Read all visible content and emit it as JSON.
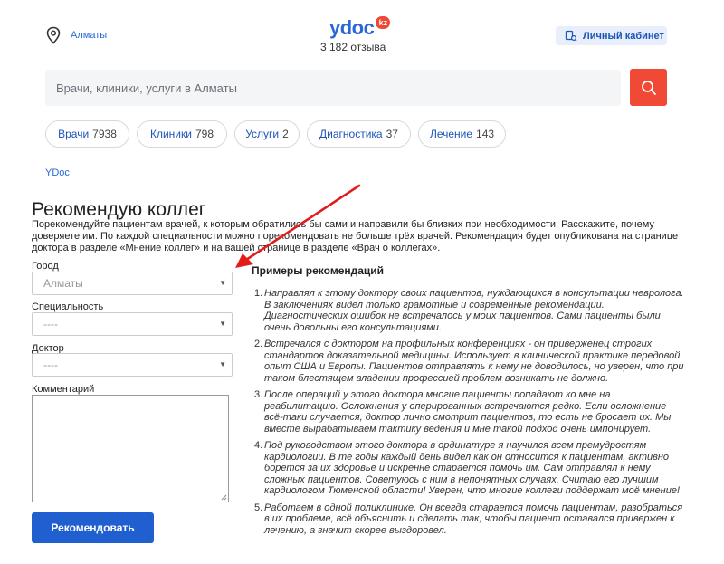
{
  "header": {
    "city": "Алматы",
    "logo_text": "ydoc",
    "logo_badge": "kz",
    "reviews": "3 182 отзыва",
    "cabinet_label": "Личный кабинет"
  },
  "search": {
    "placeholder": "Врачи, клиники, услуги в Алматы"
  },
  "chips": [
    {
      "label": "Врачи",
      "count": "7938"
    },
    {
      "label": "Клиники",
      "count": "798"
    },
    {
      "label": "Услуги",
      "count": "2"
    },
    {
      "label": "Диагностика",
      "count": "37"
    },
    {
      "label": "Лечение",
      "count": "143"
    }
  ],
  "breadcrumb": "YDoc",
  "page": {
    "title": "Рекомендую коллег",
    "description": "Порекомендуйте пациентам врачей, к которым обратились бы сами и направили бы близких при необходимости. Расскажите, почему доверяете им. По каждой специальности можно порекомендовать не больше трёх врачей. Рекомендация будет опубликована на странице доктора в разделе «Мнение коллег» и на вашей странице в разделе «Врач о коллегах»."
  },
  "form": {
    "city_label": "Город",
    "city_value": "Алматы",
    "specialty_label": "Специальность",
    "specialty_value": "----",
    "doctor_label": "Доктор",
    "doctor_value": "----",
    "comment_label": "Комментарий",
    "submit_label": "Рекомендовать"
  },
  "examples": {
    "title": "Примеры рекомендаций",
    "items": [
      {
        "num": "1.",
        "text": "Направлял к этому доктору своих пациентов, нуждающихся в консультации невролога. В заключениях видел только грамотные и современные рекомендации. Диагностических ошибок не встречалось у моих пациентов. Сами пациенты были очень довольны его консультациями."
      },
      {
        "num": "2.",
        "text": "Встречался с доктором на профильных конференциях - он приверженец строгих стандартов доказательной медицины. Использует в клинической практике передовой опыт США и Европы. Пациентов отправлять к нему не доводилось, но уверен, что при таком блестящем владении профессией проблем возникать не должно."
      },
      {
        "num": "3.",
        "text": "После операций у этого доктора многие пациенты попадают ко мне на реабилитацию. Осложнения у оперированных встречаются редко. Если осложнение всё-таки случается, доктор лично смотрит пациентов, то есть не бросает их. Мы вместе вырабатываем тактику ведения и мне такой подход очень импонирует."
      },
      {
        "num": "4.",
        "text": "Под руководством этого доктора в ординатуре я научился всем премудростям кардиологии. В те годы каждый день видел как он относится к пациентам, активно борется за их здоровье и искренне старается помочь им. Сам отправлял к нему сложных пациентов. Советуюсь с ним в непонятных случаях. Считаю его лучшим кардиологом Тюменской области! Уверен, что многие коллеги поддержат моё мнение!"
      },
      {
        "num": "5.",
        "text": "Работаем в одной поликлинике. Он всегда старается помочь пациентам, разобраться в их проблеме, всё объяснить и сделать так, чтобы пациент оставался привержен к лечению, а значит скорее выздоровел."
      }
    ]
  },
  "colors": {
    "brand_blue": "#2b68d6",
    "accent_red": "#f04a36",
    "button_blue": "#1f5fcf",
    "annotation_arrow": "#e21b1b"
  },
  "icons": [
    "location-pin-icon",
    "cabinet-user-icon",
    "search-icon",
    "chevron-down-icon",
    "annotation-arrow"
  ]
}
